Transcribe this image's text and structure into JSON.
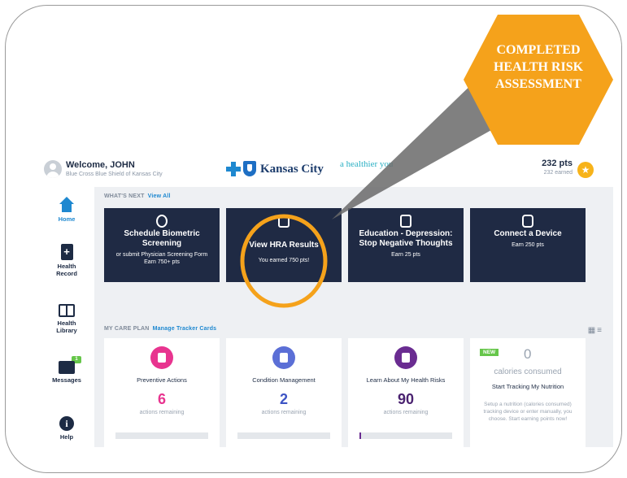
{
  "header": {
    "welcome": "Welcome, JOHN",
    "subtitle": "Blue Cross Blue Shield of Kansas City",
    "brand_name": "Kansas City",
    "brand_tagline": "a healthier you",
    "points": "232 pts",
    "points_earned": "232 earned"
  },
  "sidebar": {
    "items": [
      {
        "label": "Home",
        "icon": "home-icon",
        "active": true
      },
      {
        "label": "Health Record",
        "icon": "health-record-icon"
      },
      {
        "label": "Health Library",
        "icon": "book-icon"
      },
      {
        "label": "Messages",
        "icon": "messages-icon",
        "badge": "1"
      },
      {
        "label": "Help",
        "icon": "info-icon"
      }
    ]
  },
  "whats_next": {
    "label": "WHAT'S NEXT",
    "link": "View All",
    "cards": [
      {
        "title": "Schedule Biometric Screening",
        "sub1": "or submit Physician Screening Form",
        "sub2": "Earn 750+ pts",
        "icon": "fingerprint-icon"
      },
      {
        "title": "View HRA Results",
        "sub1": "You earned 750 pts!",
        "sub2": "",
        "icon": "clipboard-icon"
      },
      {
        "title": "Education - Depression: Stop Negative Thoughts",
        "sub1": "Earn 25 pts",
        "sub2": "",
        "icon": "book-icon"
      },
      {
        "title": "Connect a Device",
        "sub1": "Earn 250 pts",
        "sub2": "",
        "icon": "watch-icon"
      }
    ]
  },
  "care_plan": {
    "label": "MY CARE PLAN",
    "link": "Manage Tracker Cards",
    "cards": [
      {
        "title": "Preventive Actions",
        "count": "6",
        "remaining": "actions remaining",
        "color": "#e8348f",
        "progress": 0
      },
      {
        "title": "Condition Management",
        "count": "2",
        "remaining": "actions remaining",
        "color": "#5b6fd6",
        "progress": 0
      },
      {
        "title": "Learn About My Health Risks",
        "count": "90",
        "remaining": "actions remaining",
        "color": "#6a2c91",
        "progress": 0.02
      }
    ],
    "nutrition": {
      "badge": "NEW",
      "value": "0",
      "unit": "calories consumed",
      "title": "Start Tracking My Nutrition",
      "description": "Setup a nutrition (calories consumed) tracking device or enter manually, you choose. Start earning points now!"
    }
  },
  "callout": {
    "line1": "COMPLETED",
    "line2": "HEALTH RISK",
    "line3": "ASSESSMENT",
    "hex_color": "#f5a21b",
    "ring_color": "#f5a21b"
  }
}
